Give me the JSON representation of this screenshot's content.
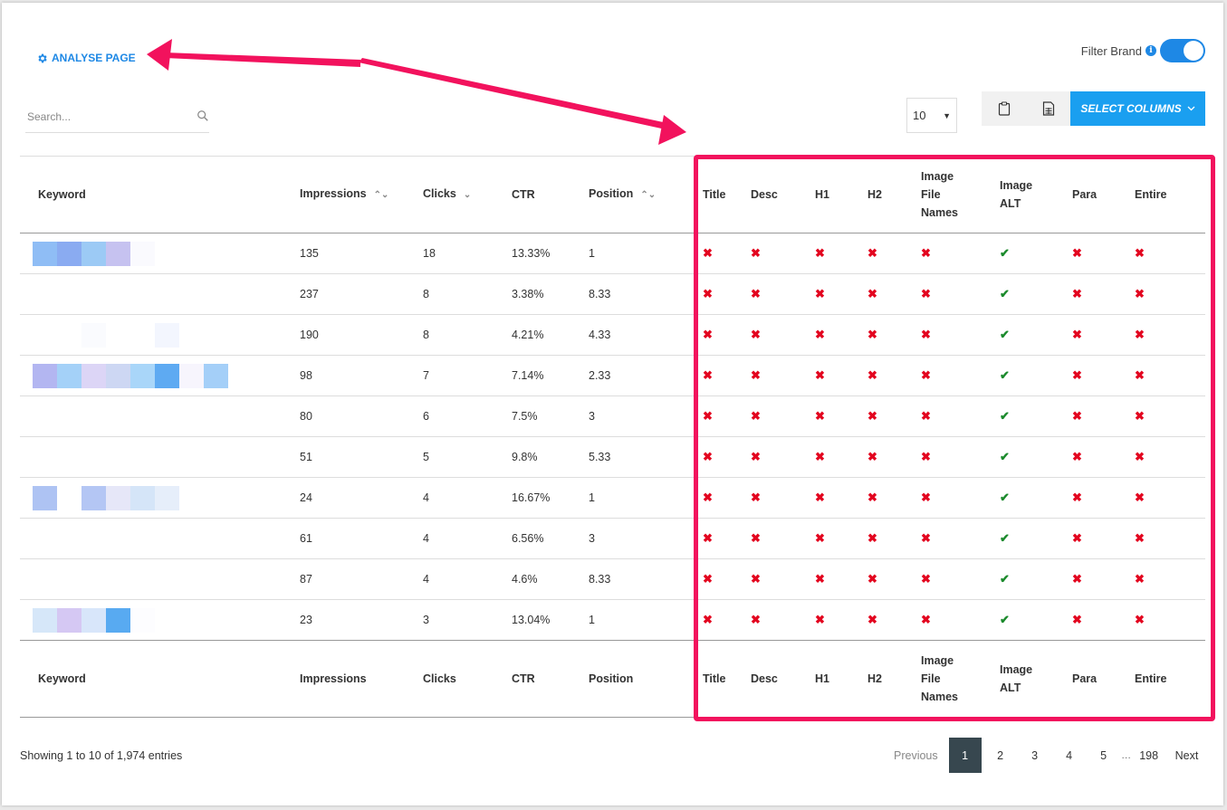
{
  "toolbar": {
    "analyse_label": "ANALYSE PAGE",
    "filter_brand_label": "Filter Brand",
    "filter_brand_on": true,
    "search_placeholder": "Search...",
    "page_size": "10",
    "select_columns_label": "SELECT COLUMNS"
  },
  "table": {
    "headers": {
      "keyword": "Keyword",
      "impressions": "Impressions",
      "clicks": "Clicks",
      "ctr": "CTR",
      "position": "Position",
      "title": "Title",
      "desc": "Desc",
      "h1": "H1",
      "h2": "H2",
      "image_file_names": [
        "Image",
        "File",
        "Names"
      ],
      "image_alt": [
        "Image",
        "ALT"
      ],
      "para": "Para",
      "entire": "Entire"
    },
    "rows": [
      {
        "impressions": "135",
        "clicks": "18",
        "ctr": "13.33%",
        "position": "1",
        "blur": [
          "#8fbdf5",
          "#8aabf1",
          "#9ccaf5",
          "#c6c2f0",
          "#fafafe"
        ]
      },
      {
        "impressions": "237",
        "clicks": "8",
        "ctr": "3.38%",
        "position": "8.33",
        "blur": []
      },
      {
        "impressions": "190",
        "clicks": "8",
        "ctr": "4.21%",
        "position": "4.33",
        "blur": [
          "#fff",
          "#fff",
          "#fafbfe",
          "#fff",
          "#fff",
          "#f3f6fe"
        ]
      },
      {
        "impressions": "98",
        "clicks": "7",
        "ctr": "7.14%",
        "position": "2.33",
        "blur": [
          "#b3b6f1",
          "#a4d1f8",
          "#dcd5f6",
          "#cdd7f3",
          "#a9d6f9",
          "#5eaaf2",
          "#f7f5fd",
          "#a4cff8"
        ]
      },
      {
        "impressions": "80",
        "clicks": "6",
        "ctr": "7.5%",
        "position": "3",
        "blur": []
      },
      {
        "impressions": "51",
        "clicks": "5",
        "ctr": "9.8%",
        "position": "5.33",
        "blur": []
      },
      {
        "impressions": "24",
        "clicks": "4",
        "ctr": "16.67%",
        "position": "1",
        "blur": [
          "#aec3f3",
          "#fff",
          "#b4c6f4",
          "#e6e7f8",
          "#d5e5f8",
          "#e6eefa"
        ]
      },
      {
        "impressions": "61",
        "clicks": "4",
        "ctr": "6.56%",
        "position": "3",
        "blur": []
      },
      {
        "impressions": "87",
        "clicks": "4",
        "ctr": "4.6%",
        "position": "8.33",
        "blur": []
      },
      {
        "impressions": "23",
        "clicks": "3",
        "ctr": "13.04%",
        "position": "1",
        "blur": [
          "#d6e7f9",
          "#d5c8f3",
          "#d8e6fa",
          "#58aaf1",
          "#fdfdff"
        ]
      }
    ],
    "check_columns": [
      "title",
      "desc",
      "h1",
      "h2",
      "image_file_names",
      "image_alt",
      "para",
      "entire"
    ],
    "check_values_per_row": [
      "x",
      "x",
      "x",
      "x",
      "x",
      "check",
      "x",
      "x"
    ],
    "glyphs": {
      "x": "✖",
      "check": "✔"
    }
  },
  "footer": {
    "info": "Showing 1 to 10 of 1,974 entries",
    "previous": "Previous",
    "pages": [
      "1",
      "2",
      "3",
      "4",
      "5"
    ],
    "ellipsis": "…",
    "last_page": "198",
    "next": "Next"
  },
  "colors": {
    "accent": "#1e88e5",
    "highlight": "#f2125d",
    "fail": "#e3051f",
    "pass": "#1b8a2c"
  }
}
